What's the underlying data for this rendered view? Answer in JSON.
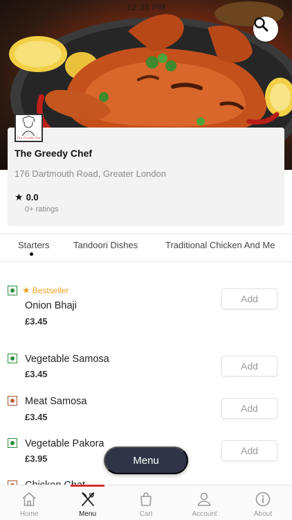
{
  "status_bar": {
    "time": "12:35 PM"
  },
  "header": {
    "search_icon": "search-icon"
  },
  "restaurant": {
    "logo_text": "The Greedy Chef",
    "name": "The Greedy Chef",
    "address": "176 Dartmouth Road, Greater London",
    "rating": "0.0",
    "rating_count": "0+ ratings"
  },
  "categories": {
    "active_index": 0,
    "items": [
      "Starters",
      "Tandoori Dishes",
      "Traditional Chicken And Me"
    ]
  },
  "menu_items": [
    {
      "name": "Onion Bhaji",
      "price": "£3.45",
      "badge": "Bestseller",
      "type": "veg",
      "add_label": "Add"
    },
    {
      "name": "Vegetable Samosa",
      "price": "£3.45",
      "type": "veg",
      "add_label": "Add"
    },
    {
      "name": "Meat Samosa",
      "price": "£3.45",
      "type": "non-veg",
      "add_label": "Add"
    },
    {
      "name": "Vegetable Pakora",
      "price": "£3.95",
      "type": "veg",
      "add_label": "Add"
    },
    {
      "name": "Chicken Chat",
      "type": "non-veg"
    }
  ],
  "menu_button": {
    "label": "Menu"
  },
  "bottom_nav": {
    "active": "Menu",
    "items": [
      {
        "label": "Home",
        "icon": "home-icon"
      },
      {
        "label": "Menu",
        "icon": "fork-knife-icon"
      },
      {
        "label": "Cart",
        "icon": "shopping-bag-icon"
      },
      {
        "label": "Account",
        "icon": "user-icon"
      },
      {
        "label": "About",
        "icon": "info-icon"
      }
    ]
  },
  "colors": {
    "accent": "#d6302d",
    "veg": "#2e8b3a",
    "non_veg": "#a0522d",
    "bestseller": "#e8a21a",
    "fab": "#2f3546"
  }
}
